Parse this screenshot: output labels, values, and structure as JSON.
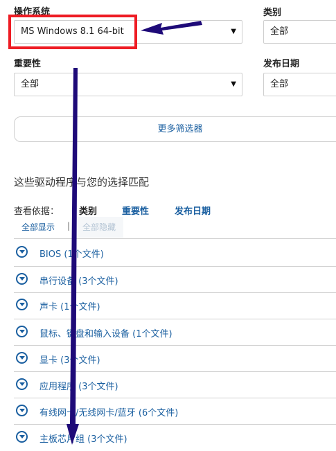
{
  "filters": {
    "os": {
      "label": "操作系统",
      "value": "MS Windows 8.1 64-bit"
    },
    "category": {
      "label": "类别",
      "value": "全部"
    },
    "importance": {
      "label": "重要性",
      "value": "全部"
    },
    "release_date": {
      "label": "发布日期",
      "value": "全部"
    },
    "more_filters": "更多筛选器"
  },
  "results": {
    "title": "这些驱动程序与您的选择匹配",
    "view_by_label": "查看依据：",
    "sort": {
      "category": "类别",
      "importance": "重要性",
      "release_date": "发布日期"
    },
    "show_all": "全部显示",
    "separator": "|",
    "hide_all": "全部隐藏",
    "categories": [
      {
        "name": "BIOS (1个文件)"
      },
      {
        "name": "串行设备 (3个文件)"
      },
      {
        "name": "声卡 (1个文件)"
      },
      {
        "name": "鼠标、键盘和输入设备 (1个文件)"
      },
      {
        "name": "显卡 (3个文件)"
      },
      {
        "name": "应用程序 (3个文件)"
      },
      {
        "name": "有线网卡/无线网卡/蓝牙 (6个文件)"
      },
      {
        "name": "主板芯片组 (3个文件)"
      }
    ]
  },
  "annotation_colors": {
    "highlight_box": "#ee1c24",
    "arrows": "#1e0a78"
  }
}
